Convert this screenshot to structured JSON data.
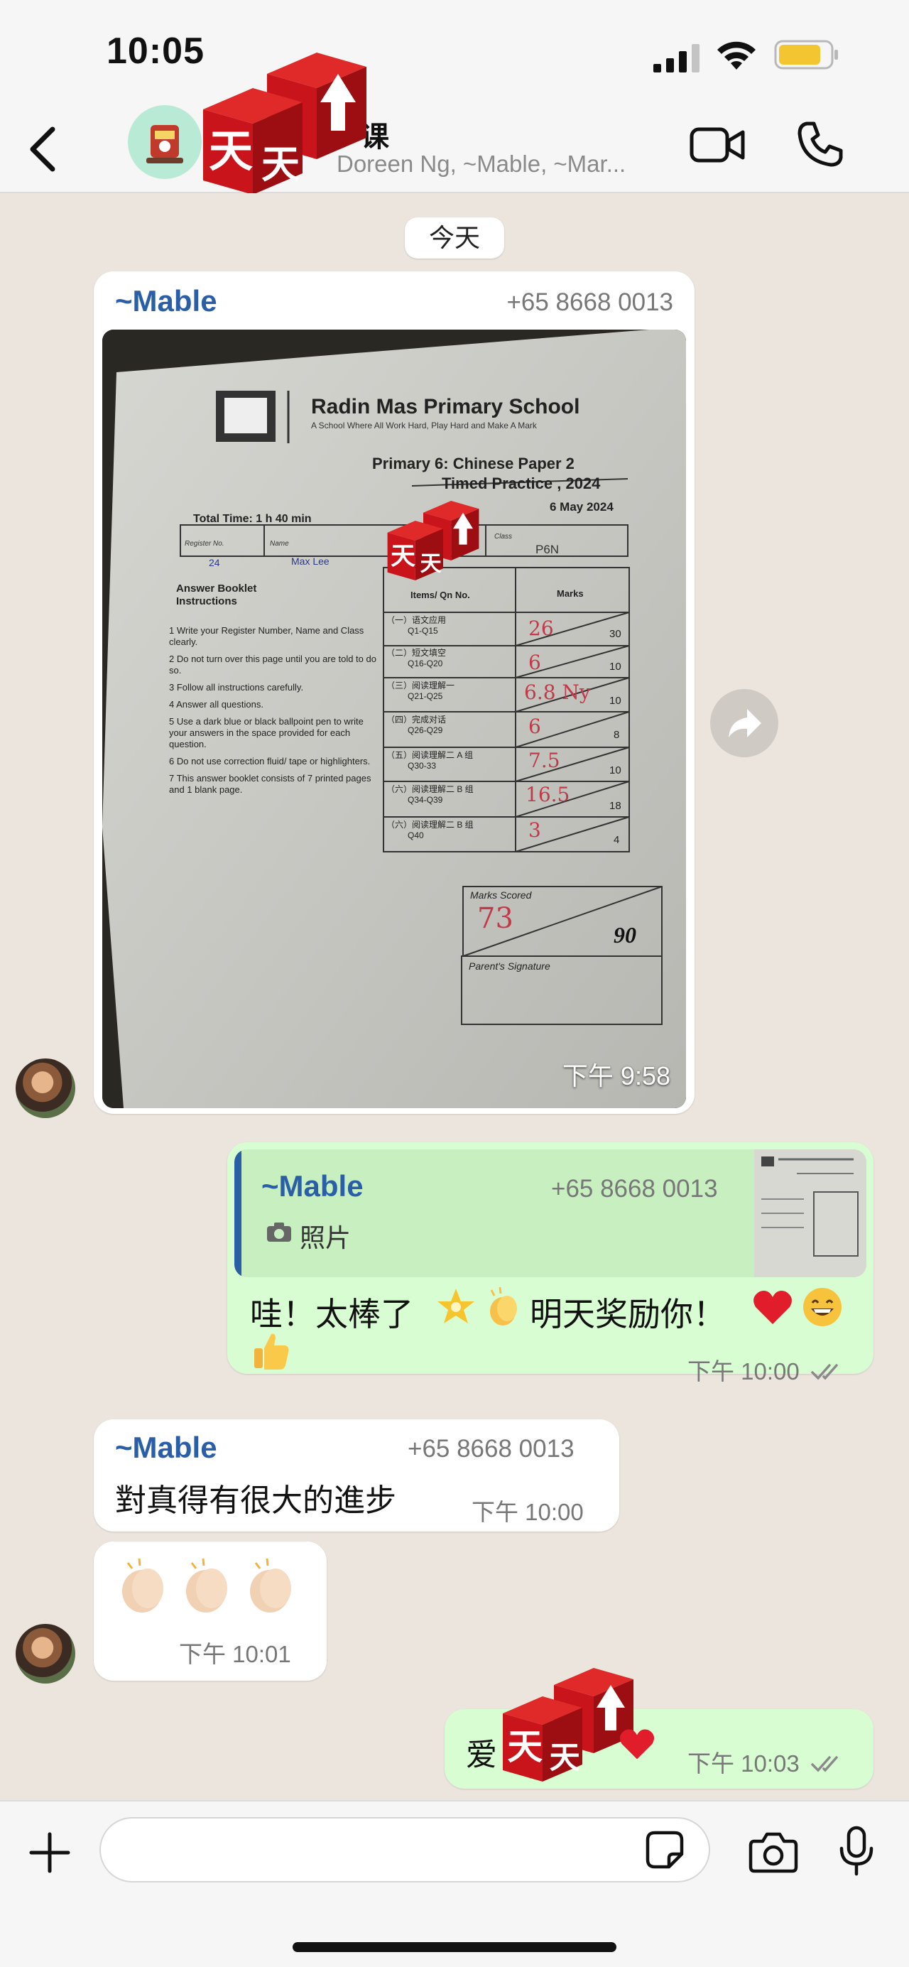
{
  "status_bar": {
    "time": "10:05"
  },
  "header": {
    "title": "课",
    "members": "Doreen Ng, ~Mable, ~Mar..."
  },
  "chat": {
    "date_label": "今天",
    "photo_message": {
      "sender": "~Mable",
      "phone": "+65 8668 0013",
      "timestamp": "下午 9:58",
      "paper": {
        "school": "Radin Mas Primary School",
        "motto": "A School Where All Work Hard, Play Hard and Make A Mark",
        "paper_title": "Primary 6: Chinese Paper 2",
        "subtitle": "Timed Practice , 2024",
        "date": "6 May 2024",
        "total_time": "Total Time:   1 h 40 min",
        "reg_label": "Register No.",
        "reg_value": "24",
        "name_label": "Name",
        "name_value": "Max Lee",
        "class_label": "Class",
        "class_value": "P6N",
        "instructions_title": "Answer Booklet Instructions",
        "instructions": [
          "1  Write your Register Number, Name and Class clearly.",
          "2  Do not turn over this page until you are told to do so.",
          "3  Follow all instructions carefully.",
          "4  Answer all questions.",
          "5  Use a dark blue or black ballpoint pen to write your answers in the space provided for each question.",
          "6  Do not use correction fluid/ tape or highlighters.",
          "7  This answer booklet consists of 7 printed pages and 1 blank page."
        ],
        "table_head_items": "Items/ Qn No.",
        "table_head_marks": "Marks",
        "rows": [
          {
            "section": "（一）语文应用",
            "qn": "Q1-Q15",
            "score": "26",
            "total": "30"
          },
          {
            "section": "（二）短文填空",
            "qn": "Q16-Q20",
            "score": "6",
            "total": "10"
          },
          {
            "section": "（三）阅读理解一",
            "qn": "Q21-Q25",
            "score": "6.8 Ny",
            "total": "10"
          },
          {
            "section": "（四）完成对话",
            "qn": "Q26-Q29",
            "score": "6",
            "total": "8"
          },
          {
            "section": "（五）阅读理解二 A 组",
            "qn": "Q30-33",
            "score": "7.5",
            "total": "10"
          },
          {
            "section": "（六）阅读理解二 B 组",
            "qn": "Q34-Q39",
            "score": "16.5",
            "total": "18"
          },
          {
            "section": "（六）阅读理解二 B 组",
            "qn": "Q40",
            "score": "3",
            "total": "4"
          }
        ],
        "marks_scored_label": "Marks Scored",
        "marks_scored": "73",
        "marks_total": "90",
        "signature_label": "Parent's Signature"
      }
    },
    "reply_message": {
      "quote_sender": "~Mable",
      "quote_phone": "+65 8668 0013",
      "quote_type": "照片",
      "text_part1": "哇！太棒了",
      "text_part2": "明天奖励你！",
      "timestamp": "下午 10:00"
    },
    "text_message": {
      "sender": "~Mable",
      "phone": "+65 8668 0013",
      "text": "對真得有很大的進步",
      "timestamp": "下午 10:00"
    },
    "clap_message": {
      "timestamp": "下午 10:01"
    },
    "last_message": {
      "text": "爱",
      "timestamp": "下午 10:03"
    }
  },
  "colors": {
    "chat_background": "#ece5dd",
    "outgoing_bubble": "#d9fdd3",
    "incoming_bubble": "#ffffff",
    "sender_name": "#2a5fa8",
    "read_ticks": "#8a8a8a",
    "logo_red": "#c8141a"
  },
  "icons": {
    "back": "chevron-left-icon",
    "video": "video-camera-icon",
    "call": "phone-icon",
    "forward": "forward-arrow-icon",
    "attach": "plus-icon",
    "sticker": "sticker-icon",
    "camera": "camera-icon",
    "mic": "microphone-icon"
  }
}
